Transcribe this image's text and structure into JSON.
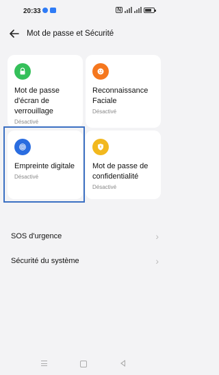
{
  "status_bar": {
    "time": "20:33"
  },
  "header": {
    "title": "Mot de passe et Sécurité"
  },
  "cards": [
    {
      "label": "Mot de passe d'écran de verrouillage",
      "status": "Désactivé",
      "icon": "lock-icon",
      "color": "#35c05a"
    },
    {
      "label": "Reconnaissance Faciale",
      "status": "Désactivé",
      "icon": "face-icon",
      "color": "#f5771e"
    },
    {
      "label": "Empreinte digitale",
      "status": "Désactivé",
      "icon": "fingerprint-icon",
      "color": "#2a6de0"
    },
    {
      "label": "Mot de passe de confidentialité",
      "status": "Désactivé",
      "icon": "privacy-shield-icon",
      "color": "#f2b81e"
    }
  ],
  "list": [
    {
      "label": "SOS d'urgence"
    },
    {
      "label": "Sécurité du système"
    }
  ],
  "chevron": "›"
}
